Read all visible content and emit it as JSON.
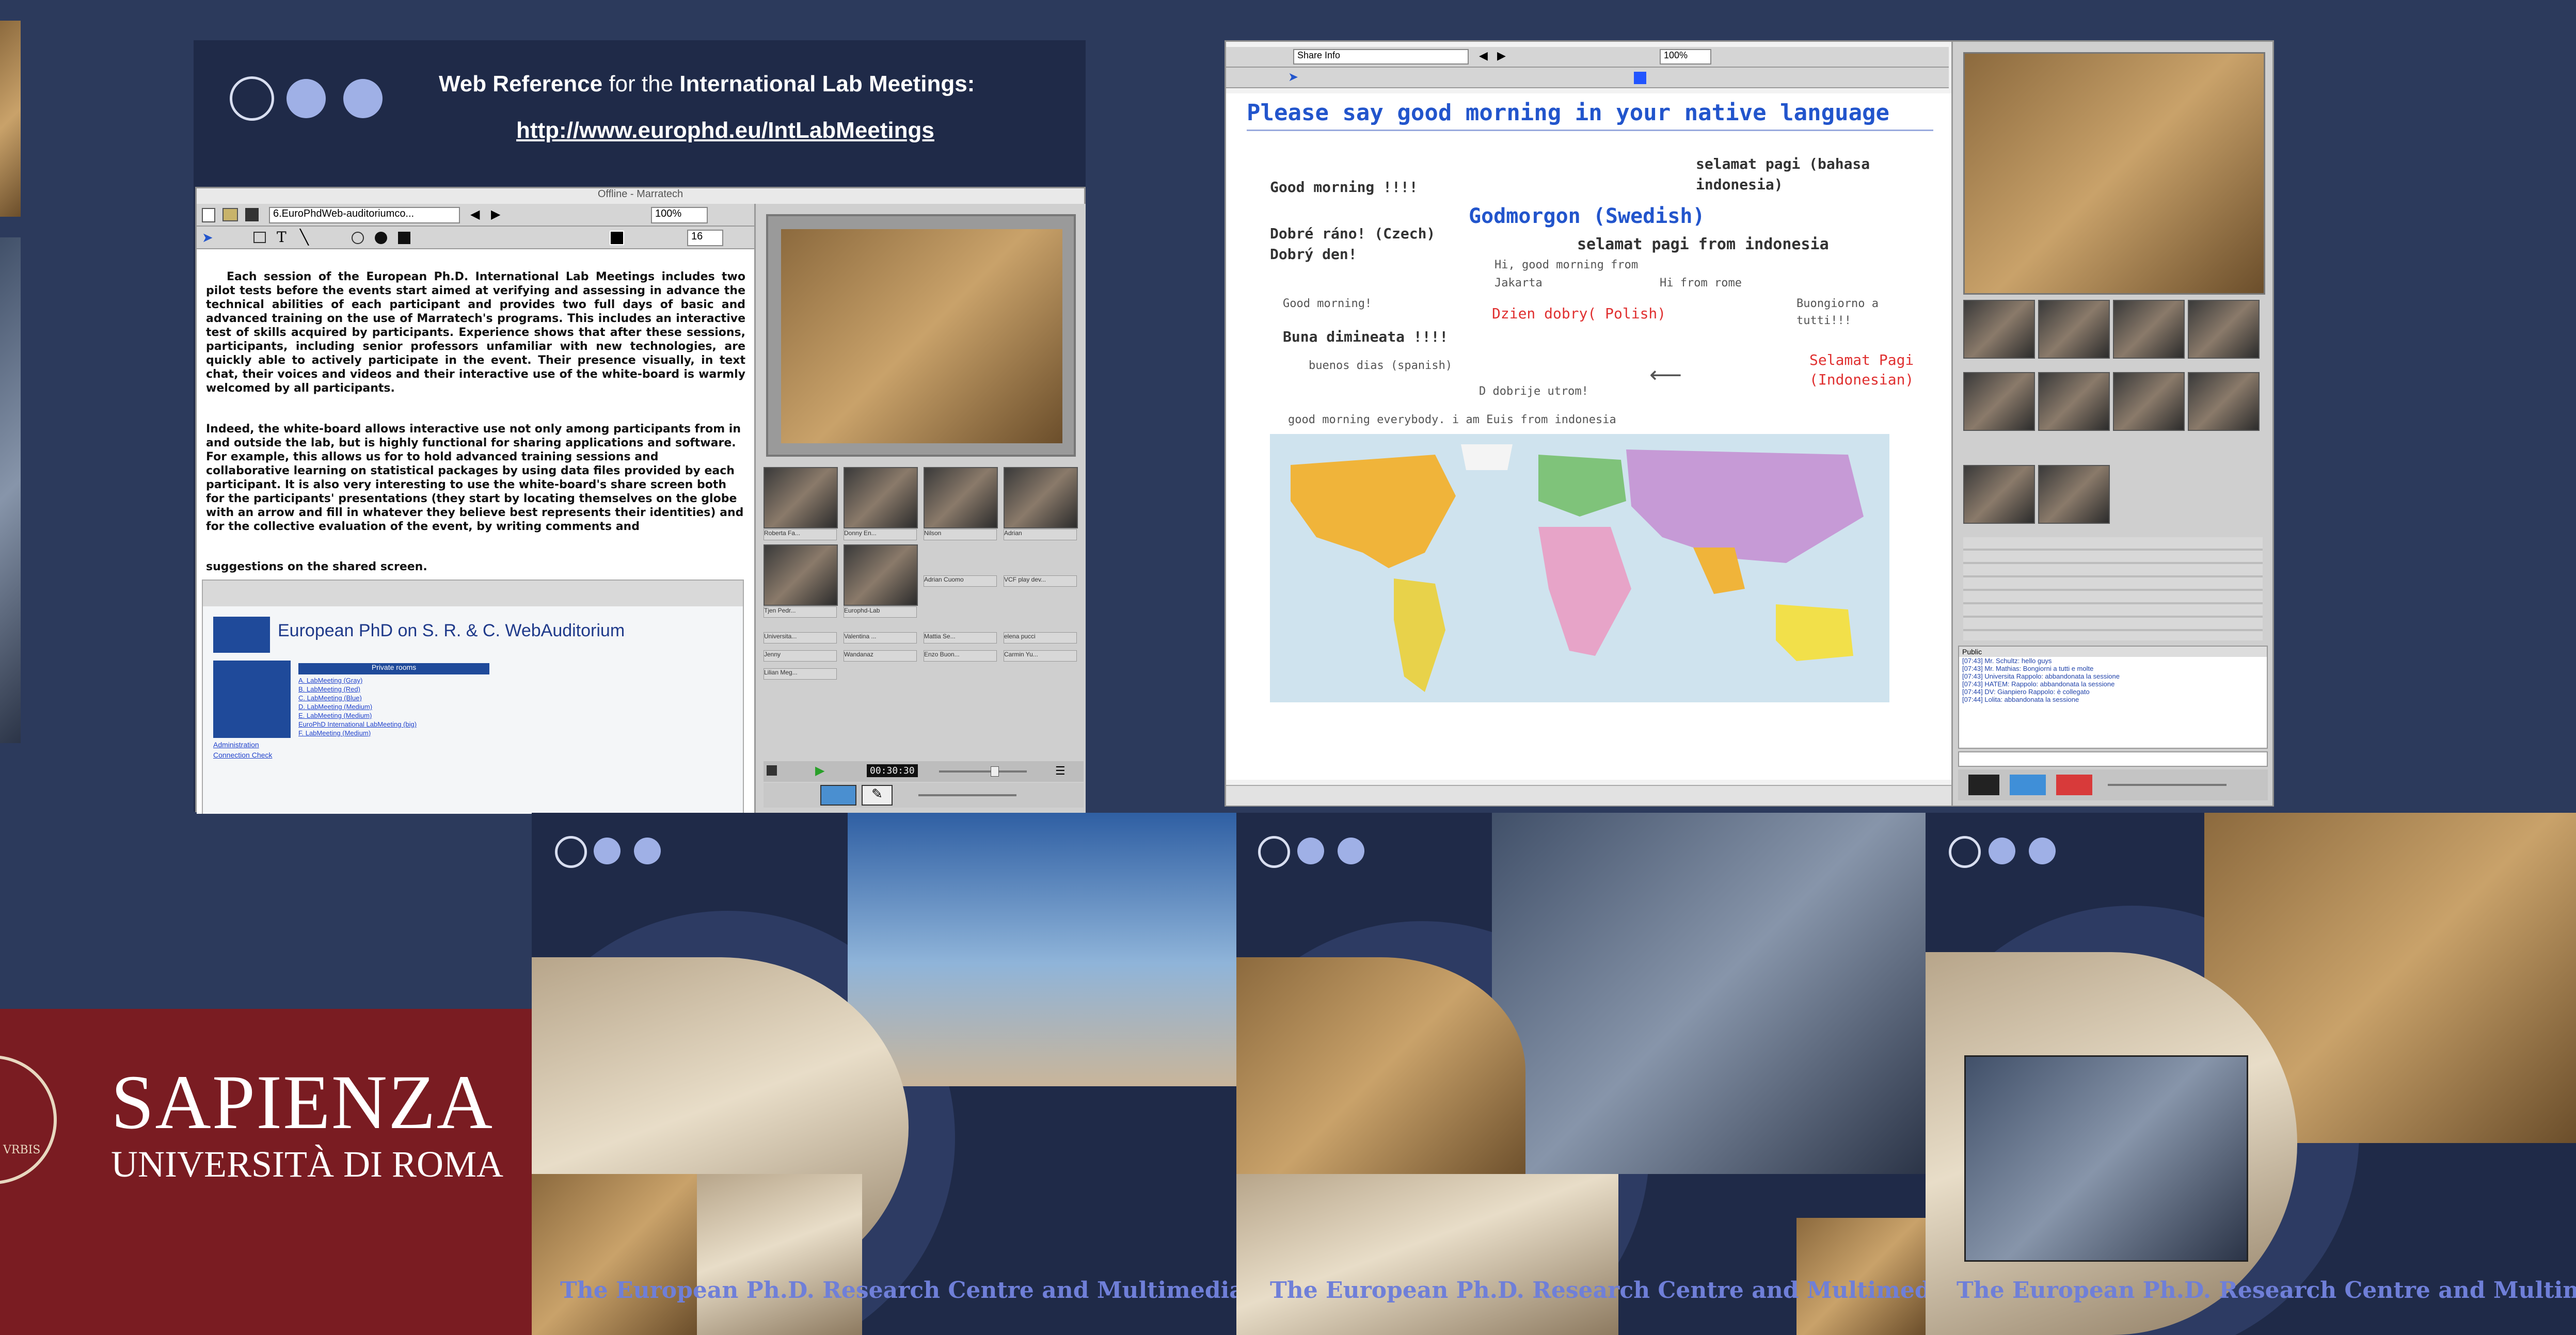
{
  "topbar": {
    "cropped_title": ""
  },
  "webref": {
    "label_bold_1": "Web Reference",
    "label_normal": " for the ",
    "label_bold_2": "International Lab Meetings:",
    "url": "http://www.europhd.eu/IntLabMeetings"
  },
  "marratech1": {
    "window_title": "Offline - Marratech",
    "doc_select": "6.EuroPhdWeb-auditoriumco...",
    "zoom": "100%",
    "pen_size": "16",
    "body_text": "Each session of the European Ph.D. International Lab Meetings includes two pilot tests before the events start aimed at verifying and assessing in advance the technical abilities of each participant and provides two full days of basic and advanced training on the use of Marratech's programs. This includes an interactive test of skills acquired by participants. Experience shows that after these sessions, participants, including senior professors unfamiliar with new technologies, are quickly able to actively participate in the event. Their presence visually, in text chat, their voices and videos and their interactive use of the white-board is warmly welcomed by all participants.",
    "body_text_2": "Indeed, the white-board allows interactive use not only among participants from in and outside the lab, but is highly functional for sharing applications and software. For example, this allows us for to hold advanced training sessions and collaborative learning on statistical packages by using data files provided by each participant. It is also very interesting to use the white-board's share screen both for the participants' presentations (they start by locating themselves on the globe with an arrow and fill in whatever they believe best represents their identities) and for the collective evaluation of the event, by writing comments and",
    "body_text_3": "suggestions on the shared screen.",
    "web_heading": "European PhD on S. R. & C. WebAuditorium",
    "sidebar_links": [
      "Administration",
      "Connection Check"
    ],
    "private_rooms_header": "Private rooms",
    "rooms": [
      "A. LabMeeting (Gray)",
      "B. LabMeeting (Red)",
      "C. LabMeeting (Blue)",
      "D. LabMeeting (Medium)",
      "E. LabMeeting (Medium)",
      "EuroPhD International LabMeeting (big)",
      "F. LabMeeting (Medium)"
    ],
    "timer": "00:30:30",
    "participants": [
      "Roberta Fa...",
      "Donny En...",
      "Nilson",
      "Adrian",
      "Tjen Pedr...",
      "Europhd-Lab",
      "Adrian Cuomo",
      "VCF play dev...",
      "Universita...",
      "Valentina ...",
      "Mattia Se...",
      "elena pucci",
      "Jenny",
      "Wandanaz",
      "Enzo Buon...",
      "Carmin Yu...",
      "Lilian Meg..."
    ]
  },
  "marratech2": {
    "doc_select": "Share Info",
    "zoom": "100%",
    "headline": "Please say good morning in your native language",
    "greetings": [
      {
        "text": "Good morning !!!!",
        "color": "#333333"
      },
      {
        "text": "selamat pagi (bahasa",
        "color": "#333333"
      },
      {
        "text": "indonesia)",
        "color": "#333333"
      },
      {
        "text": "Godmorgon (Swedish)",
        "color": "#2255cc"
      },
      {
        "text": "Dobré ráno! (Czech)",
        "color": "#333333"
      },
      {
        "text": "Dobrý den!",
        "color": "#333333"
      },
      {
        "text": "selamat pagi from indonesia",
        "color": "#333333"
      },
      {
        "text": "Hi, good morning from",
        "color": "#555555"
      },
      {
        "text": "Jakarta",
        "color": "#555555"
      },
      {
        "text": "Hi from rome",
        "color": "#555555"
      },
      {
        "text": "Good morning!",
        "color": "#555555"
      },
      {
        "text": "Dzien dobry( Polish)",
        "color": "#e03030"
      },
      {
        "text": "Buongiorno a",
        "color": "#555555"
      },
      {
        "text": "tutti!!!",
        "color": "#555555"
      },
      {
        "text": "Buna dimineata !!!!",
        "color": "#333333"
      },
      {
        "text": "Selamat Pagi",
        "color": "#e03030"
      },
      {
        "text": "(Indonesian)",
        "color": "#e03030"
      },
      {
        "text": "buenos dias (spanish)",
        "color": "#555555"
      },
      {
        "text": "D dobrije utrom!",
        "color": "#555555"
      },
      {
        "text": "good morning everybody. i am Euis from indonesia",
        "color": "#555555"
      }
    ],
    "chat_header": "Public",
    "chat_lines": [
      "[07:43] Mr. Schultz: hello guys",
      "[07:43] Mr. Mathias: Bongiorni a tutti e molte",
      "[07:43] Universita Rappolo: abbandonata la sessione",
      "[07:43] HATEM: Rappolo: abbandonata la sessione",
      "[07:44] DV: Gianpiero Rappolo: è collegato",
      "[07:44] Lolita: abbandonata la sessione"
    ]
  },
  "panels": [
    {
      "footer": "The  European Ph.D. Research Centre and Multimedia Lab"
    },
    {
      "footer": "The  European Ph.D. Research Centre and Multimedia Lab"
    },
    {
      "footer": "The  European Ph.D. Research Centre and Multimedia L"
    }
  ],
  "sapienza": {
    "name": "SAPIENZA",
    "subtitle": "UNIVERSITÀ DI ROMA",
    "seal_text": "VRBIS"
  },
  "colors": {
    "background": "#2c3a5c",
    "panel_navy": "#1f2a48",
    "footer_text": "#6f7fd8",
    "sapienza_red": "#7a1c22",
    "headline_blue": "#2255cc"
  }
}
